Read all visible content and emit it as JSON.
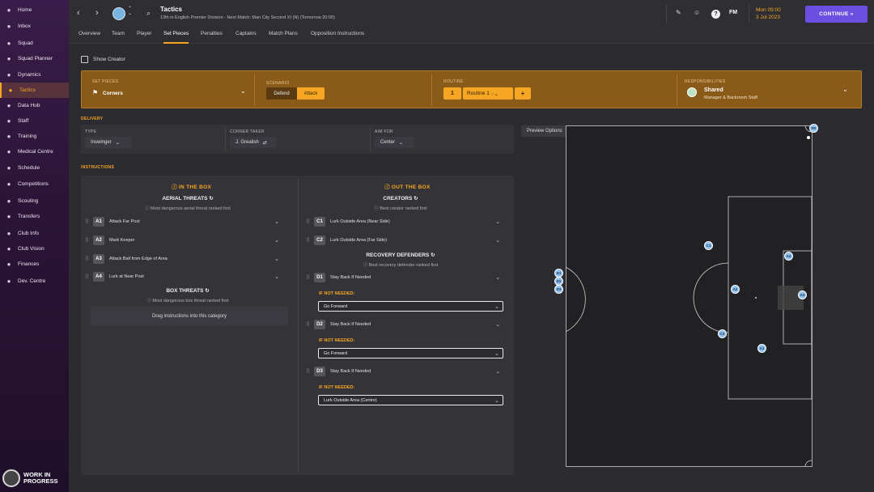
{
  "sidebar": {
    "items": [
      {
        "label": "Home",
        "icon": "home-icon"
      },
      {
        "label": "Inbox",
        "icon": "inbox-icon"
      },
      {
        "label": "Squad",
        "icon": "squad-icon"
      },
      {
        "label": "Squad Planner",
        "icon": "planner-icon"
      },
      {
        "label": "Dynamics",
        "icon": "dynamics-icon"
      },
      {
        "label": "Tactics",
        "icon": "tactics-icon"
      },
      {
        "label": "Data Hub",
        "icon": "datahub-icon"
      },
      {
        "label": "Staff",
        "icon": "staff-icon"
      },
      {
        "label": "Training",
        "icon": "training-icon"
      },
      {
        "label": "Medical Centre",
        "icon": "medical-icon"
      },
      {
        "label": "Schedule",
        "icon": "schedule-icon"
      },
      {
        "label": "Competitions",
        "icon": "trophy-icon"
      },
      {
        "label": "Scouting",
        "icon": "scouting-icon"
      },
      {
        "label": "Transfers",
        "icon": "transfers-icon"
      },
      {
        "label": "Club Info",
        "icon": "club-info-icon"
      },
      {
        "label": "Club Vision",
        "icon": "vision-icon"
      },
      {
        "label": "Finances",
        "icon": "finances-icon"
      },
      {
        "label": "Dev. Centre",
        "icon": "dev-centre-icon"
      }
    ],
    "active": "Tactics",
    "wip_line1": "WORK IN",
    "wip_line2": "PROGRESS"
  },
  "header": {
    "title": "Tactics",
    "subtitle": "13th in English Premier Division - Next Match: Man City Second XI (N) (Tomorrow 20:00)",
    "fm": "FM",
    "date_day": "Mon 09:00",
    "date": "3 Jul 2023",
    "continue": "CONTINUE"
  },
  "tabs": [
    "Overview",
    "Team",
    "Player",
    "Set Pieces",
    "Penalties",
    "Captains",
    "Match Plans",
    "Opposition Instructions"
  ],
  "active_tab": "Set Pieces",
  "show_creator": "Show Creator",
  "setpiece": {
    "set_pieces_label": "SET PIECES",
    "set_piece": "Corners",
    "scenario_label": "SCENARIO",
    "defend": "Defend",
    "attack": "Attack",
    "routine_label": "ROUTINE",
    "routine_num": "1",
    "routine_name": "Routine 1",
    "plus": "+",
    "resp_label": "RESPONSIBILITIES",
    "resp": "Shared",
    "resp_sub": "Manager & Backroom Staff"
  },
  "delivery": {
    "title": "DELIVERY",
    "type_label": "TYPE",
    "type": "Inswinger",
    "taker_label": "CORNER TAKER",
    "taker": "J. Grealish",
    "aim_label": "AIM FOR",
    "aim": "Center",
    "preview": "Preview Options"
  },
  "instructions": {
    "title": "INSTRUCTIONS",
    "in_box": "IN THE BOX",
    "out_box": "OUT THE BOX",
    "aerial_title": "AERIAL THREATS",
    "aerial_sub": "Most dangerous aerial threat ranked first",
    "aerial": [
      {
        "code": "A1",
        "text": "Attack Far Post"
      },
      {
        "code": "A2",
        "text": "Mark Keeper"
      },
      {
        "code": "A3",
        "text": "Attack Ball from Edge of Area"
      },
      {
        "code": "A4",
        "text": "Lurk at Near Post"
      }
    ],
    "box_title": "BOX THREATS",
    "box_sub": "Most dangerous box threat ranked first",
    "box_drag": "Drag instructions into this category",
    "creators_title": "CREATORS",
    "creators_sub": "Best creator ranked first",
    "creators": [
      {
        "code": "C1",
        "text": "Lurk Outside Area (Near Side)"
      },
      {
        "code": "C2",
        "text": "Lurk Outside Area (Far Side)"
      }
    ],
    "recovery_title": "RECOVERY DEFENDERS",
    "recovery_sub": "Best recovery defender ranked first",
    "defenders": [
      {
        "code": "D1",
        "text": "Stay Back If Needed",
        "ifnot": "IF NOT NEEDED:",
        "fallback": "Go Forward"
      },
      {
        "code": "D2",
        "text": "Stay Back If Needed",
        "ifnot": "IF NOT NEEDED:",
        "fallback": "Go Forward"
      },
      {
        "code": "D3",
        "text": "Stay Back If Needed",
        "ifnot": "IF NOT NEEDED:",
        "fallback": "Lurk Outside Area (Centre)"
      }
    ]
  },
  "pitch": {
    "players": [
      "FK",
      "C1",
      "A4",
      "A2",
      "A3",
      "C2",
      "A1",
      "D1",
      "D3",
      "D2"
    ]
  }
}
